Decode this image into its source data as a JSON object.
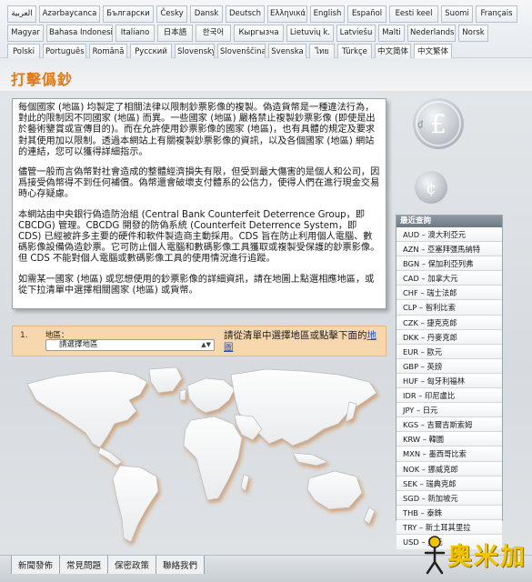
{
  "languages": {
    "row1": [
      "العربية",
      "Azərbaycanca",
      "Български",
      "Česky",
      "Dansk",
      "Deutsch",
      "Ελληνικά",
      "English",
      "Español",
      "Eesti keel",
      "Suomi",
      "Français"
    ],
    "row2": [
      "Magyar",
      "Bahasa Indonesia",
      "Italiano",
      "日本語",
      "한국어",
      "Кыргызча",
      "Lietuvių k.",
      "Latviešu",
      "Malti",
      "Nederlands",
      "Norsk"
    ],
    "row3": [
      "Polski",
      "Português",
      "Română",
      "Русский",
      "Slovensky",
      "Slovenščina",
      "Svenska",
      "ไทย",
      "Türkçe",
      "中文简体",
      "中文繁体"
    ],
    "active": "中文繁体"
  },
  "page_title": "打擊僞鈔",
  "intro": {
    "p1": "每個國家 (地區) 均製定了相關法律以限制鈔票影像的複製。偽造貨幣是一種違法行為，對此的限制因不同國家 (地區) 而異。一些國家 (地區) 嚴格禁止複製鈔票影像 (即使是出於藝術鑒賞或宣傳目的)。而在允許使用鈔票影像的國家 (地區)，也有具體的規定及要求對其使用加以限制。透過本網站上有關複製鈔票影像的資訊，以及各個國家 (地區) 網站的連結，您可以獲得詳細指示。",
    "p2": "儘管一般而言偽幣對社會造成的整體經濟損失有限，但受到最大傷害的是個人和公司，因爲接受偽幣得不到任何補償。偽幣還會破壞支付體系的公信力，使得人們在進行現金交易時心存疑慮。",
    "p3": "本網站由中央銀行偽造防治組 (Central Bank Counterfeit Deterrence Group，即 CBCDG) 管理。CBCDG 開發的防偽系統 (Counterfeit Deterrence System，即 CDS) 已經被許多主要的硬件和軟件製造商主動採用。CDS 旨在防止利用個人電腦、數碼影像設備偽造鈔票。它可防止個人電腦和數碼影像工具獲取或複製受保護的鈔票影像。但 CDS 不能對個人電腦或數碼影像工具的使用情況進行追蹤。",
    "p4": "如需某一國家 (地區) 或您想使用的鈔票影像的詳細資訊，請在地圖上點選相應地區，或從下拉清單中選擇相關國家 (地區) 或貨幣。"
  },
  "selector": {
    "step": "1.",
    "label": "地區：",
    "selected": "請選擇地區",
    "instruction": "請從清單中選擇地區或點擊下面的",
    "map_link": "地圖"
  },
  "sidebar": {
    "title": "最近查詢",
    "items": [
      "AUD – 澳大利亞元",
      "AZN – 亞塞拜彊馬納特",
      "BGN – 保加利亞列弗",
      "CAD – 加拿大元",
      "CHF – 瑞士法郎",
      "CLP – 智利比索",
      "CZK – 捷克克郎",
      "DKK – 丹麥克郎",
      "EUR – 歐元",
      "GBP – 英鎊",
      "HUF – 匈牙利福林",
      "IDR – 印尼盧比",
      "JPY – 日元",
      "KGS – 吉爾吉斯索姆",
      "KRW – 韓圜",
      "MXN – 墨西哥比索",
      "NOK – 挪威克郎",
      "SEK – 瑞典克郎",
      "SGD – 新加坡元",
      "THB – 泰銖",
      "TRY – 新土耳其里拉",
      "USD – 美元"
    ]
  },
  "footer": {
    "links": [
      "新聞發佈",
      "常見問題",
      "保密政策",
      "聯絡我們"
    ]
  },
  "watermark": {
    "text": "奥米加"
  },
  "colors": {
    "title": "#e07a1a",
    "selector_bg": "#f6d7ae",
    "sidebar_header": "#7b8690"
  },
  "icons": [
    "pound-coin-icon",
    "cent-coin-icon",
    "world-map",
    "dropdown-arrow-icon"
  ]
}
